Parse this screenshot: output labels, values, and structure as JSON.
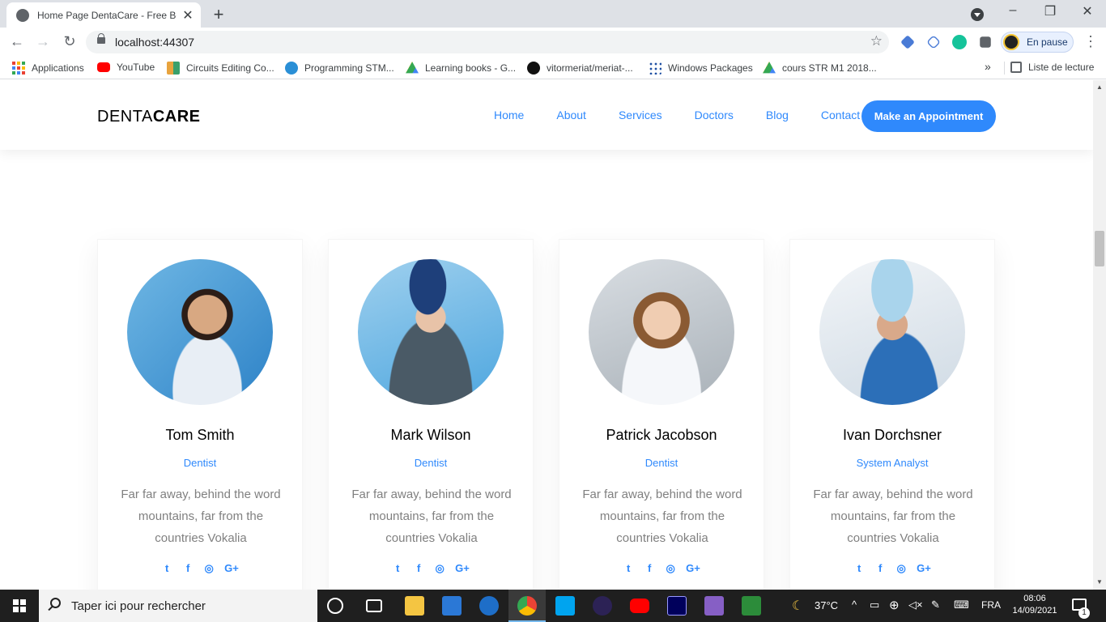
{
  "browser": {
    "tab_title": "Home Page DentaCare - Free Bootstrap",
    "new_tab": "+",
    "url": "localhost:44307",
    "profile_status": "En pause",
    "window_controls": {
      "minimize": "–",
      "restore": "❐",
      "close": "✕"
    },
    "bookmarks": [
      {
        "label": "Applications",
        "icon": "apps-grid-icon",
        "color": "#ea4335"
      },
      {
        "label": "YouTube",
        "icon": "youtube-icon",
        "color": "#ff0000"
      },
      {
        "label": "Circuits Editing Co...",
        "icon": "circuits-icon",
        "color": "#e8a33d"
      },
      {
        "label": "Programming STM...",
        "icon": "globe-icon",
        "color": "#2a8fd6"
      },
      {
        "label": "Learning books - G...",
        "icon": "drive-icon",
        "color": "#34a853"
      },
      {
        "label": "vitormeriat/meriat-...",
        "icon": "github-icon",
        "color": "#111111"
      },
      {
        "label": "Windows Packages",
        "icon": "packages-icon",
        "color": "#1e4fa3"
      },
      {
        "label": "cours STR M1 2018...",
        "icon": "drive-icon",
        "color": "#fbbc04"
      }
    ],
    "bookmarks_more": "»",
    "reading_list": "Liste de lecture"
  },
  "site": {
    "brand_light": "DENTA",
    "brand_bold": "CARE",
    "nav": [
      "Home",
      "About",
      "Services",
      "Doctors",
      "Blog",
      "Contact"
    ],
    "cta": "Make an Appointment",
    "accent": "#2f89fc",
    "doctors": [
      {
        "name": "Tom Smith",
        "role": "Dentist",
        "bio": "Far far away, behind the word mountains, far from the countries Vokalia"
      },
      {
        "name": "Mark Wilson",
        "role": "Dentist",
        "bio": "Far far away, behind the word mountains, far from the countries Vokalia"
      },
      {
        "name": "Patrick Jacobson",
        "role": "Dentist",
        "bio": "Far far away, behind the word mountains, far from the countries Vokalia"
      },
      {
        "name": "Ivan Dorchsner",
        "role": "System Analyst",
        "bio": "Far far away, behind the word mountains, far from the countries Vokalia"
      }
    ],
    "social": {
      "twitter": "t",
      "facebook": "f",
      "instagram": "◎",
      "google_plus": "G+"
    }
  },
  "taskbar": {
    "search_placeholder": "Taper ici pour rechercher",
    "weather": "37°C",
    "language": "FRA",
    "time": "08:06",
    "date": "14/09/2021",
    "notification_count": "1",
    "mail_badge": "1"
  }
}
